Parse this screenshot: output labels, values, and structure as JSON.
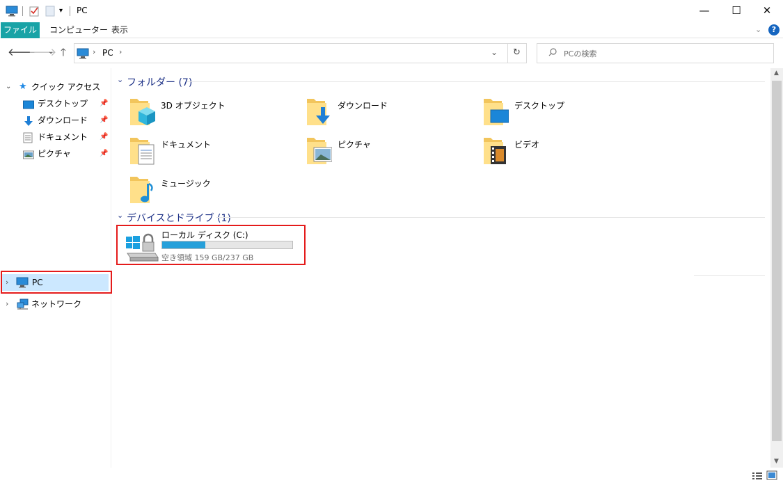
{
  "window": {
    "title": "PC",
    "minimize_glyph": "—",
    "maximize_glyph": "☐",
    "close_glyph": "✕"
  },
  "ribbon": {
    "tabs": [
      {
        "label": "ファイル",
        "active": true
      },
      {
        "label": "コンピューター",
        "active": false
      },
      {
        "label": "表示",
        "active": false
      }
    ],
    "help_icon": "question-icon"
  },
  "navigation": {
    "back_icon": "arrow-left-icon",
    "forward_icon": "arrow-right-icon",
    "recent_icon": "chevron-down-icon",
    "up_icon": "arrow-up-icon",
    "breadcrumb": [
      "PC"
    ],
    "refresh_icon": "refresh-icon",
    "search_placeholder": "PCの検索"
  },
  "sidebar": {
    "quick_access": {
      "label": "クイック アクセス",
      "items": [
        {
          "label": "デスクトップ",
          "icon": "desktop-icon"
        },
        {
          "label": "ダウンロード",
          "icon": "download-icon"
        },
        {
          "label": "ドキュメント",
          "icon": "document-icon"
        },
        {
          "label": "ピクチャ",
          "icon": "picture-icon"
        }
      ]
    },
    "pc": {
      "label": "PC",
      "selected": true
    },
    "network": {
      "label": "ネットワーク"
    }
  },
  "main": {
    "folders_header": "フォルダー (7)",
    "folders": [
      {
        "label": "3D オブジェクト",
        "icon": "3d-objects-folder-icon"
      },
      {
        "label": "ダウンロード",
        "icon": "downloads-folder-icon"
      },
      {
        "label": "デスクトップ",
        "icon": "desktop-folder-icon"
      },
      {
        "label": "ドキュメント",
        "icon": "documents-folder-icon"
      },
      {
        "label": "ピクチャ",
        "icon": "pictures-folder-icon"
      },
      {
        "label": "ビデオ",
        "icon": "videos-folder-icon"
      },
      {
        "label": "ミュージック",
        "icon": "music-folder-icon"
      }
    ],
    "drives_header": "デバイスとドライブ (1)",
    "drive": {
      "label": "ローカル ディスク (C:)",
      "space_text": "空き領域 159 GB/237 GB",
      "used_fraction": 0.33,
      "icon": "windows-drive-icon"
    }
  },
  "colors": {
    "accent": "#19a3a6",
    "header_text": "#1e3287",
    "selection": "#cce8ff",
    "drive_bar": "#26a0da",
    "highlight_frame": "#e41b1b"
  }
}
